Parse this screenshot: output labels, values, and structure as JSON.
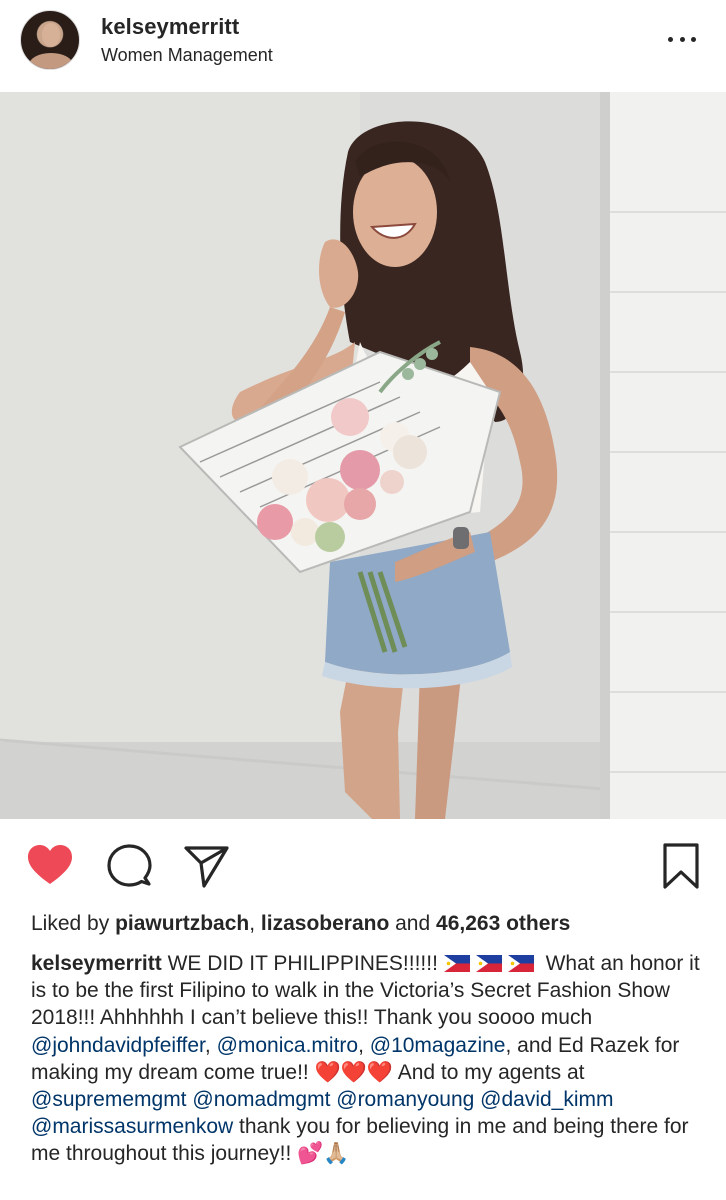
{
  "header": {
    "username": "kelseymerritt",
    "subtitle": "Women Management",
    "more_icon": "more-horizontal-icon"
  },
  "actions": {
    "like_icon": "heart-filled-icon",
    "comment_icon": "comment-icon",
    "share_icon": "send-icon",
    "save_icon": "bookmark-icon",
    "like_color": "#ed4956"
  },
  "likes": {
    "prefix": "Liked by ",
    "user1": "piawurtzbach",
    "separator": ", ",
    "user2": "lizasoberano",
    "middle": " and ",
    "count_text": "46,263 others"
  },
  "caption": {
    "username": "kelseymerritt",
    "t1": " WE DID IT PHILIPPINES!!!!!! ",
    "t2": " What an honor it is to be the first Filipino to walk in the Victoria’s Secret Fashion Show 2018!!! Ahhhhhh I can’t believe this!! Thank you soooo much ",
    "m1": "@johndavidpfeiffer",
    "t3": ", ",
    "m2": "@monica.mitro",
    "t4": ", ",
    "m3": "@10magazine",
    "t5": ", and Ed Razek for making my dream come true!! ",
    "hearts": "❤️❤️❤️",
    "t6": " And to my agents at ",
    "m4": "@suprememgmt",
    "t7": " ",
    "m5": "@nomadmgmt",
    "t8": " ",
    "m6": "@romanyoung",
    "t9": " ",
    "m7": "@david_kimm",
    "t10": " ",
    "m8": "@marissasurmenkow",
    "t11": " thank you for believing in me and being there for me throughout this journey!! ",
    "end_emoji": "💕🙏🏼"
  },
  "colors": {
    "text": "#262626",
    "mention": "#003569"
  }
}
